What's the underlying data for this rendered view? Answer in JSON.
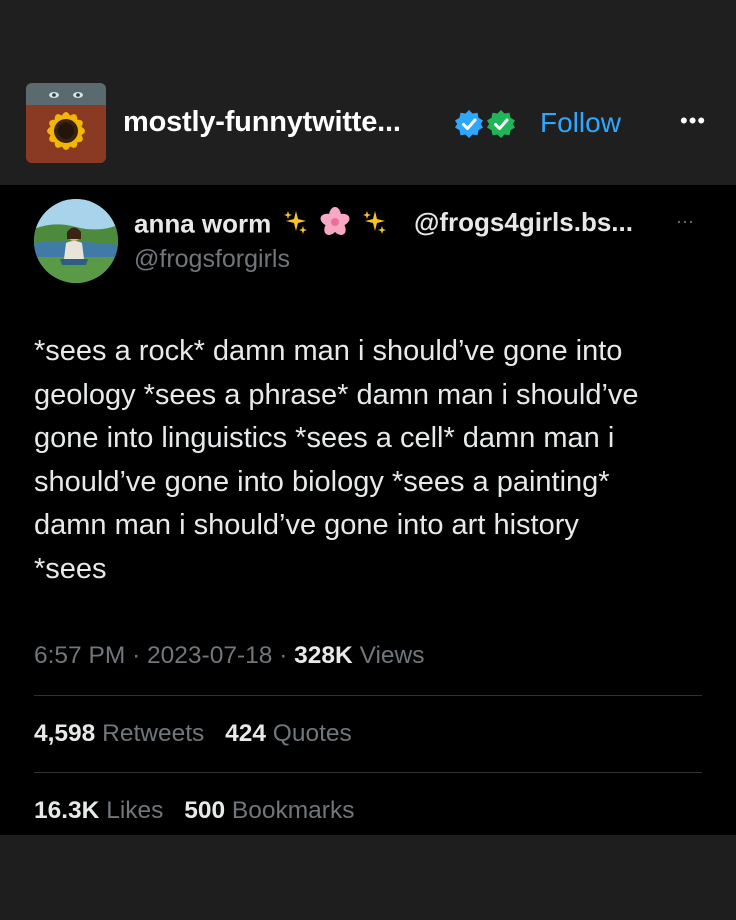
{
  "header": {
    "blog_name": "mostly-funnytwitte...",
    "follow_label": "Follow",
    "more_label": "•••",
    "badge_icons": [
      "verified-blue-check-icon",
      "verified-green-check-icon"
    ]
  },
  "tweet": {
    "display_name": "anna worm",
    "name_emojis": [
      "sparkles-icon",
      "cherry-blossom-icon",
      "sparkles-icon"
    ],
    "alt_handle": "@frogs4girls.bs...",
    "handle": "@frogsforgirls",
    "more_label": "···",
    "text": "*sees a rock* damn man i should’ve gone into\ngeology *sees a phrase* damn man i should’ve\ngone into linguistics *sees a cell* damn man i\nshould’ve gone into biology *sees a painting*\ndamn man i should’ve gone into art history\n*sees",
    "time": "6:57 PM",
    "date": "2023-07-18",
    "separator": "·",
    "views_count": "328K",
    "views_label": "Views",
    "retweets_count": "4,598",
    "retweets_label": "Retweets",
    "quotes_count": "424",
    "quotes_label": "Quotes",
    "likes_count": "16.3K",
    "likes_label": "Likes",
    "bookmarks_count": "500",
    "bookmarks_label": "Bookmarks"
  },
  "colors": {
    "accent": "#2ea8ff",
    "verified_green": "#1fb65a",
    "muted_text": "#71767b"
  }
}
